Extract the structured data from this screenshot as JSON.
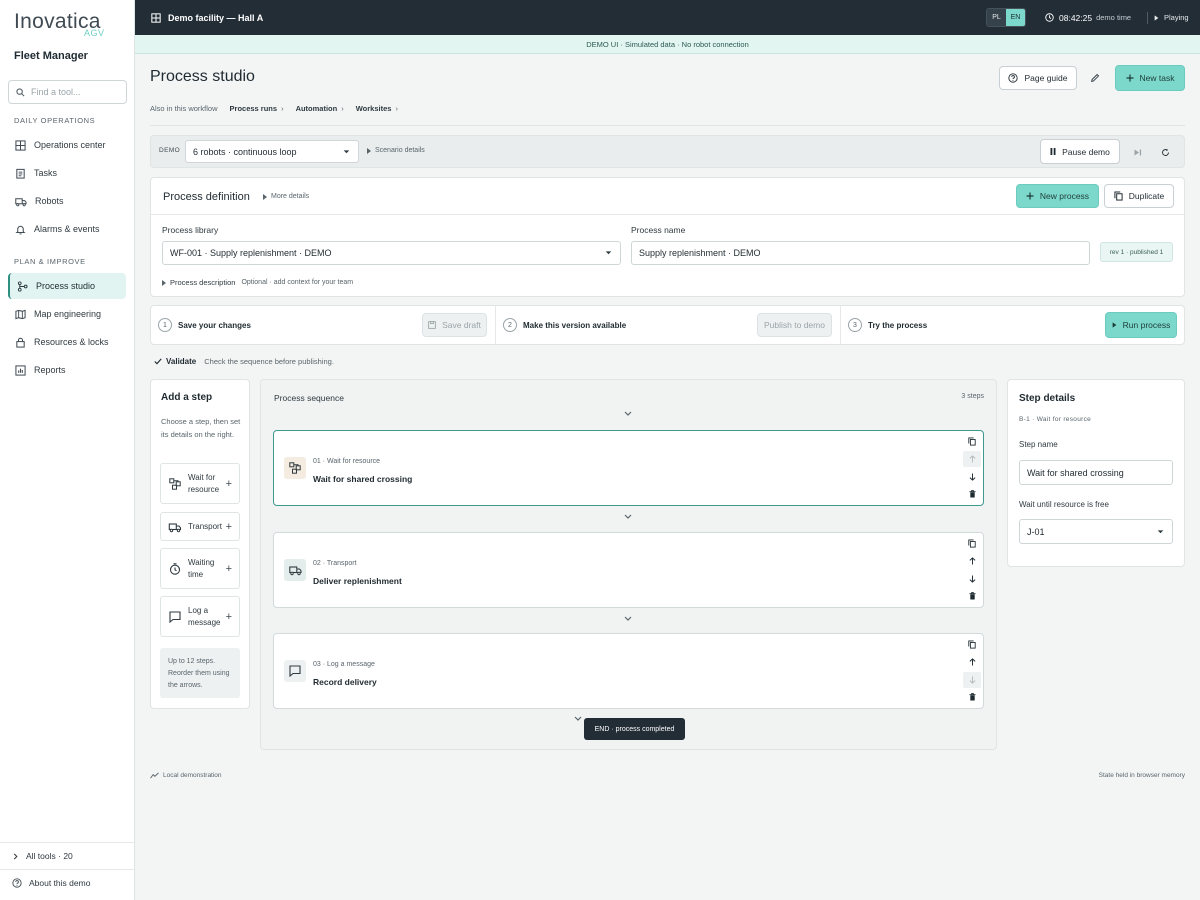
{
  "sidebar": {
    "logo": "Inovatica",
    "logo_sub": "AGV",
    "app_name": "Fleet Manager",
    "search_placeholder": "Find a tool...",
    "section_daily": "DAILY OPERATIONS",
    "section_plan": "PLAN & IMPROVE",
    "items": [
      {
        "label": "Operations center",
        "icon": "grid-icon"
      },
      {
        "label": "Tasks",
        "icon": "clipboard-icon"
      },
      {
        "label": "Robots",
        "icon": "truck-icon"
      },
      {
        "label": "Alarms & events",
        "icon": "bell-icon"
      },
      {
        "label": "Process studio",
        "icon": "workflow-icon",
        "active": true
      },
      {
        "label": "Map engineering",
        "icon": "map-icon"
      },
      {
        "label": "Resources & locks",
        "icon": "lock-icon"
      },
      {
        "label": "Reports",
        "icon": "chart-icon"
      }
    ],
    "all_tools": "All tools · 20",
    "about": "About this demo"
  },
  "topbar": {
    "title": "Demo facility — Hall A",
    "lang_pl": "PL",
    "lang_en": "EN",
    "time": "08:42:25",
    "time_label": "demo time",
    "status": "Playing"
  },
  "demo_banner": "DEMO UI · Simulated data · No robot connection",
  "header": {
    "title": "Process studio",
    "page_guide": "Page guide",
    "new_task": "New task",
    "crumb_intro": "Also in this workflow",
    "crumbs": [
      "Process runs",
      "Automation",
      "Worksites"
    ]
  },
  "demo_strip": {
    "tag": "DEMO",
    "scenario": "6 robots · continuous loop",
    "scenario_details": "Scenario details",
    "pause": "Pause demo"
  },
  "definition": {
    "title": "Process definition",
    "more": "More details",
    "new_process": "New process",
    "duplicate": "Duplicate",
    "library_label": "Process library",
    "library_value": "WF-001 · Supply replenishment · DEMO",
    "name_label": "Process name",
    "name_value": "Supply replenishment · DEMO",
    "revision": "rev 1 · published 1",
    "description_label": "Process description",
    "description_hint": "Optional · add context for your team"
  },
  "stepbar": {
    "s1_num": "1",
    "s1_label": "Save your changes",
    "s1_button": "Save draft",
    "s2_num": "2",
    "s2_label": "Make this version available",
    "s2_button": "Publish to demo",
    "s3_num": "3",
    "s3_label": "Try the process",
    "s3_button": "Run process"
  },
  "validate": {
    "label": "Validate",
    "hint": "Check the sequence before publishing."
  },
  "add_step": {
    "title": "Add a step",
    "intro": "Choose a step, then set its details on the right.",
    "items": [
      {
        "label": "Wait for resource",
        "icon": "resource-icon"
      },
      {
        "label": "Transport",
        "icon": "truck-icon"
      },
      {
        "label": "Waiting time",
        "icon": "timer-icon"
      },
      {
        "label": "Log a message",
        "icon": "message-icon"
      }
    ],
    "note": "Up to 12 steps. Reorder them using the arrows."
  },
  "sequence": {
    "title": "Process sequence",
    "count": "3 steps",
    "steps": [
      {
        "sub": "01 · Wait for resource",
        "name": "Wait for shared crossing",
        "icon": "resource-icon"
      },
      {
        "sub": "02 · Transport",
        "name": "Deliver replenishment",
        "icon": "truck-icon"
      },
      {
        "sub": "03 · Log a message",
        "name": "Record delivery",
        "icon": "message-icon"
      }
    ],
    "end": "END · process completed"
  },
  "details": {
    "title": "Step details",
    "id": "B-1 · Wait for resource",
    "name_label": "Step name",
    "name_value": "Wait for shared crossing",
    "resource_label": "Wait until resource is free",
    "resource_value": "J-01"
  },
  "footer": {
    "left": "Local demonstration",
    "right": "State held in browser memory"
  },
  "colors": {
    "accent": "#7dd8cc",
    "topbar": "#232d36",
    "selected_border": "#3e9a8e"
  }
}
